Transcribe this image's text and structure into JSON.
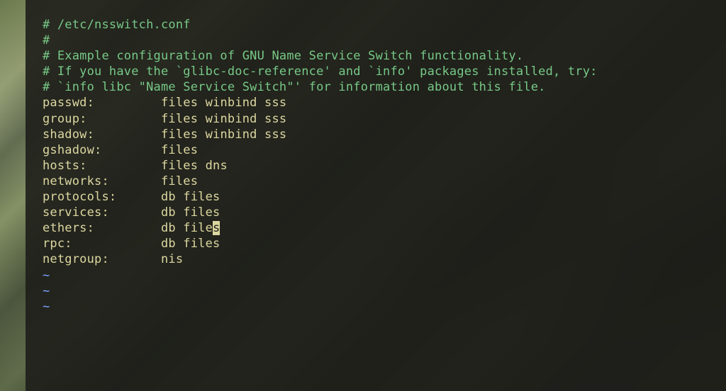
{
  "comments": {
    "c1": "# /etc/nsswitch.conf",
    "c2": "#",
    "c3": "# Example configuration of GNU Name Service Switch functionality.",
    "c4": "# If you have the `glibc-doc-reference' and `info' packages installed, try:",
    "c5": "# `info libc \"Name Service Switch\"' for information about this file."
  },
  "entries": {
    "passwd": {
      "key": "passwd:",
      "pad": "         ",
      "val": "files winbind sss"
    },
    "group": {
      "key": "group:",
      "pad": "          ",
      "val": "files winbind sss"
    },
    "shadow": {
      "key": "shadow:",
      "pad": "         ",
      "val": "files winbind sss"
    },
    "gshadow": {
      "key": "gshadow:",
      "pad": "        ",
      "val": "files"
    },
    "hosts": {
      "key": "hosts:",
      "pad": "          ",
      "val": "files dns"
    },
    "networks": {
      "key": "networks:",
      "pad": "       ",
      "val": "files"
    },
    "protocols": {
      "key": "protocols:",
      "pad": "      ",
      "val": "db files"
    },
    "services": {
      "key": "services:",
      "pad": "       ",
      "val": "db files"
    },
    "ethers": {
      "key": "ethers:",
      "pad": "         ",
      "val_pre": "db file",
      "val_cursor": "s"
    },
    "rpc": {
      "key": "rpc:",
      "pad": "            ",
      "val": "db files"
    },
    "netgroup": {
      "key": "netgroup:",
      "pad": "       ",
      "val": "nis"
    }
  },
  "blank": "",
  "tilde": "~"
}
